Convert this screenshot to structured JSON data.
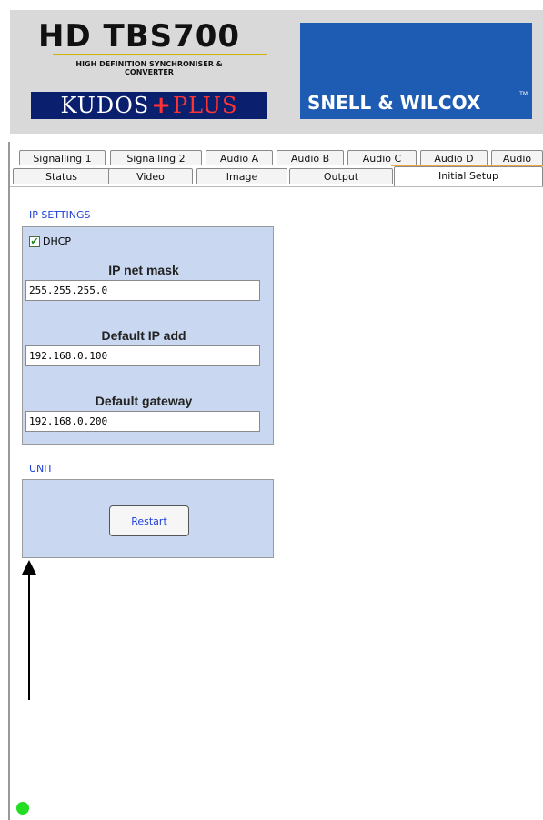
{
  "header": {
    "product_title": "HD TBS700",
    "product_subtitle_line1": "HIGH DEFINITION SYNCHRONISER &",
    "product_subtitle_line2": "CONVERTER",
    "kudos_left": "KUDOS",
    "kudos_plus": "+",
    "kudos_right": "PLUS",
    "company": "SNELL & WILCOX",
    "trademark": "TM"
  },
  "tabs": {
    "row1": [
      "Signalling 1",
      "Signalling 2",
      "Audio A",
      "Audio B",
      "Audio C",
      "Audio D",
      "Audio"
    ],
    "row2": [
      "Status",
      "Video",
      "Image",
      "Output",
      "Initial Setup"
    ],
    "active": "Initial Setup"
  },
  "ip_settings": {
    "section_label": "IP SETTINGS",
    "dhcp_label": "DHCP",
    "dhcp_checked": true,
    "netmask_label": "IP net mask",
    "netmask_value": "255.255.255.0",
    "default_ip_label": "Default IP add",
    "default_ip_value": "192.168.0.100",
    "gateway_label": "Default gateway",
    "gateway_value": "192.168.0.200"
  },
  "unit": {
    "section_label": "UNIT",
    "restart_label": "Restart"
  },
  "colors": {
    "panel_bg": "#c9d8f0",
    "section_label": "#1d3fd8",
    "status_led": "#22dd22",
    "snell_blue": "#1e5bb3",
    "kudos_navy": "#0a1f6e"
  }
}
